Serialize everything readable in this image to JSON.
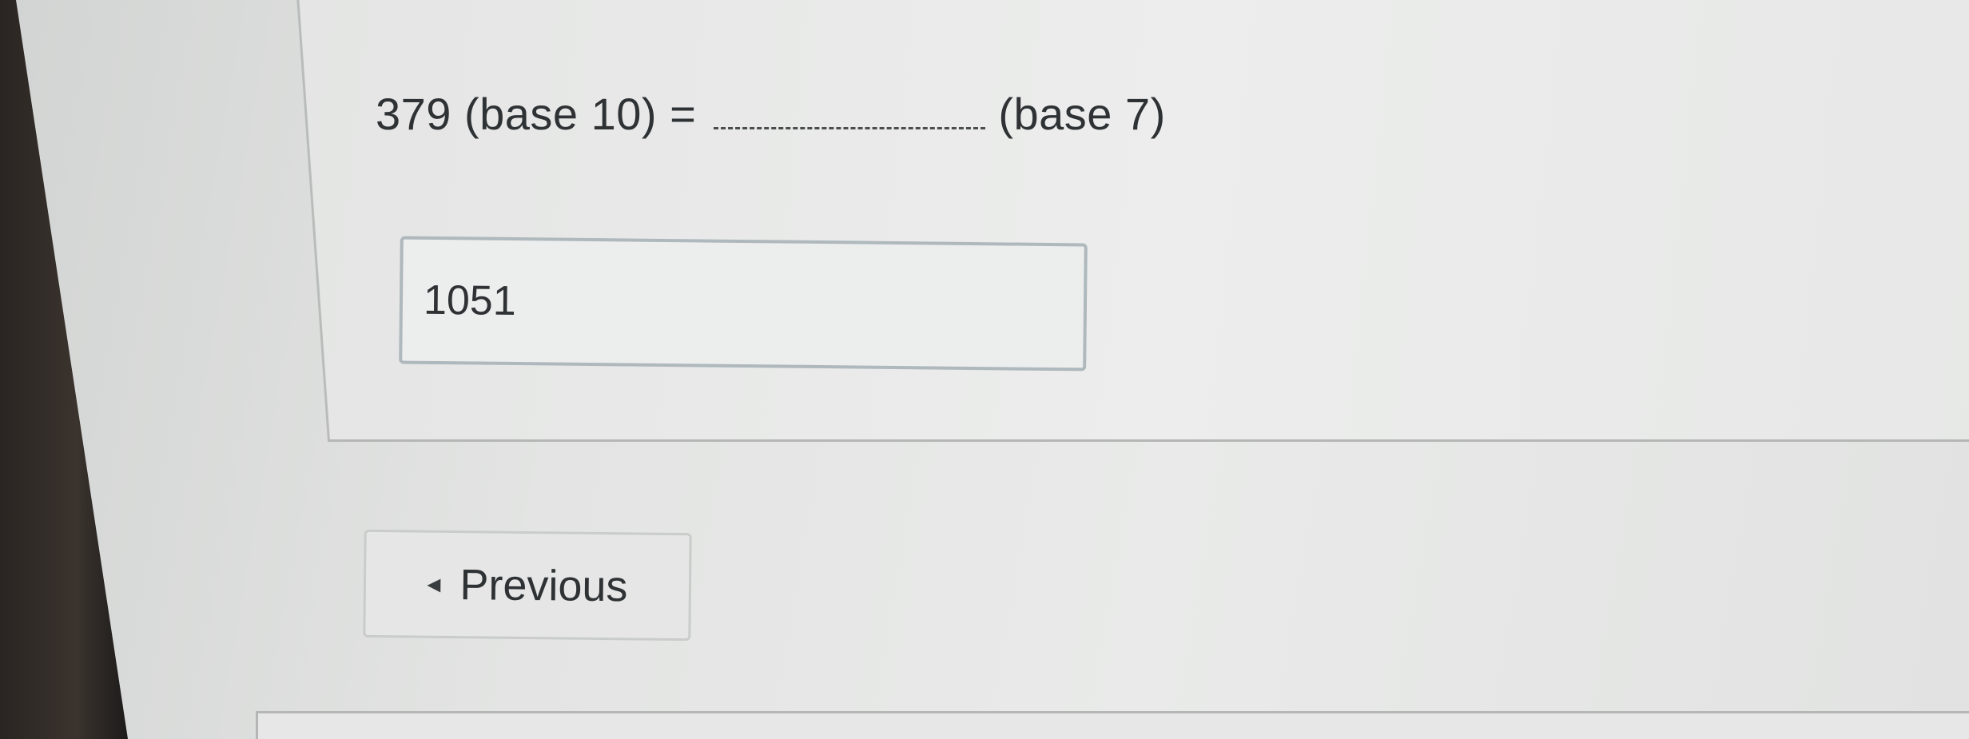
{
  "question": {
    "left_text": "379 (base 10) =",
    "right_text": "(base 7)"
  },
  "answer": {
    "value": "1051"
  },
  "navigation": {
    "previous_label": "Previous",
    "previous_icon": "caret-left-icon"
  }
}
